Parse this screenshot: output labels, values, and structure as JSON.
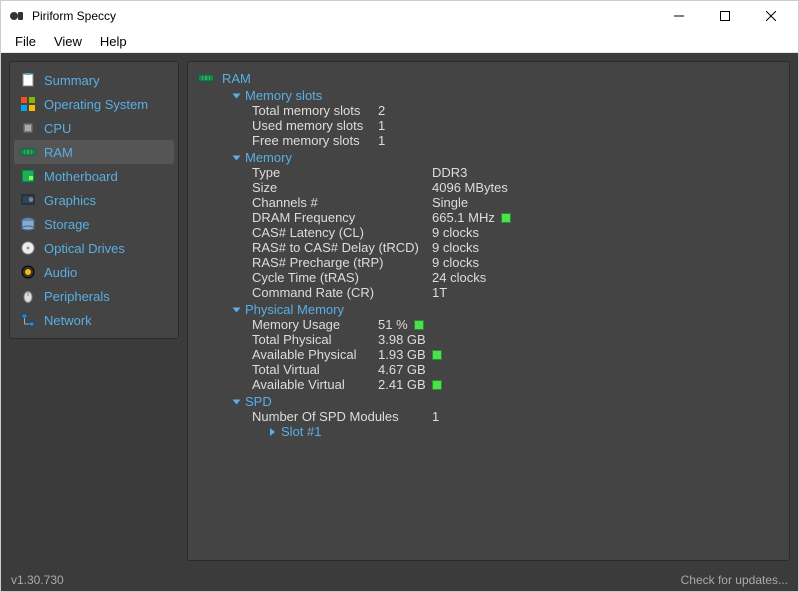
{
  "window": {
    "title": "Piriform Speccy"
  },
  "menu": [
    "File",
    "View",
    "Help"
  ],
  "sidebar": {
    "items": [
      {
        "label": "Summary"
      },
      {
        "label": "Operating System"
      },
      {
        "label": "CPU"
      },
      {
        "label": "RAM"
      },
      {
        "label": "Motherboard"
      },
      {
        "label": "Graphics"
      },
      {
        "label": "Storage"
      },
      {
        "label": "Optical Drives"
      },
      {
        "label": "Audio"
      },
      {
        "label": "Peripherals"
      },
      {
        "label": "Network"
      }
    ],
    "activeIndex": 3
  },
  "main": {
    "header": "RAM",
    "memory_slots": {
      "title": "Memory slots",
      "rows": [
        {
          "label": "Total memory slots",
          "value": "2"
        },
        {
          "label": "Used memory slots",
          "value": "1"
        },
        {
          "label": "Free memory slots",
          "value": "1"
        }
      ]
    },
    "memory": {
      "title": "Memory",
      "rows": [
        {
          "label": "Type",
          "value": "DDR3"
        },
        {
          "label": "Size",
          "value": "4096 MBytes"
        },
        {
          "label": "Channels #",
          "value": "Single"
        },
        {
          "label": "DRAM Frequency",
          "value": "665.1 MHz",
          "indicator": true
        },
        {
          "label": "CAS# Latency (CL)",
          "value": "9 clocks"
        },
        {
          "label": "RAS# to CAS# Delay (tRCD)",
          "value": "9 clocks"
        },
        {
          "label": "RAS# Precharge (tRP)",
          "value": "9 clocks"
        },
        {
          "label": "Cycle Time (tRAS)",
          "value": "24 clocks"
        },
        {
          "label": "Command Rate (CR)",
          "value": "1T"
        }
      ]
    },
    "phys_mem": {
      "title": "Physical Memory",
      "rows": [
        {
          "label": "Memory Usage",
          "value": "51 %",
          "indicator": true
        },
        {
          "label": "Total Physical",
          "value": "3.98 GB"
        },
        {
          "label": "Available Physical",
          "value": "1.93 GB",
          "indicator": true
        },
        {
          "label": "Total Virtual",
          "value": "4.67 GB"
        },
        {
          "label": "Available Virtual",
          "value": "2.41 GB",
          "indicator": true
        }
      ]
    },
    "spd": {
      "title": "SPD",
      "rows": [
        {
          "label": "Number Of SPD Modules",
          "value": "1"
        }
      ],
      "sub": "Slot #1"
    }
  },
  "status": {
    "version": "v1.30.730",
    "updates": "Check for updates..."
  }
}
